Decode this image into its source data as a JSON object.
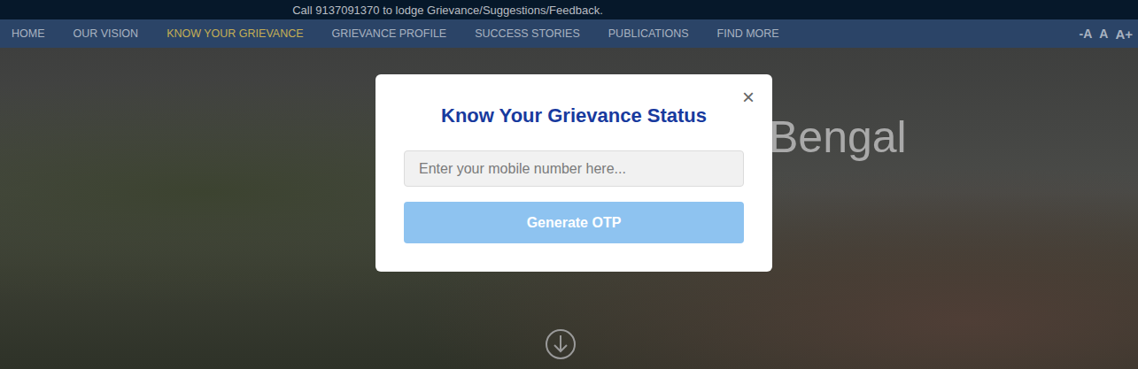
{
  "top_bar": {
    "text": "Call 9137091370 to lodge Grievance/Suggestions/Feedback."
  },
  "nav": {
    "items": [
      {
        "label": "HOME",
        "selected": false
      },
      {
        "label": "OUR VISION",
        "selected": false
      },
      {
        "label": "KNOW YOUR GRIEVANCE",
        "selected": true
      },
      {
        "label": "GRIEVANCE PROFILE",
        "selected": false
      },
      {
        "label": "SUCCESS STORIES",
        "selected": false
      },
      {
        "label": "PUBLICATIONS",
        "selected": false
      },
      {
        "label": "FIND MORE",
        "selected": false
      }
    ]
  },
  "font_size_controls": [
    "-A",
    "A",
    "A+"
  ],
  "hero": {
    "title": "Bengal"
  },
  "modal": {
    "title": "Know Your Grievance Status",
    "close": "×",
    "input": {
      "placeholder": "Enter your mobile number here..."
    },
    "button": "Generate OTP"
  }
}
